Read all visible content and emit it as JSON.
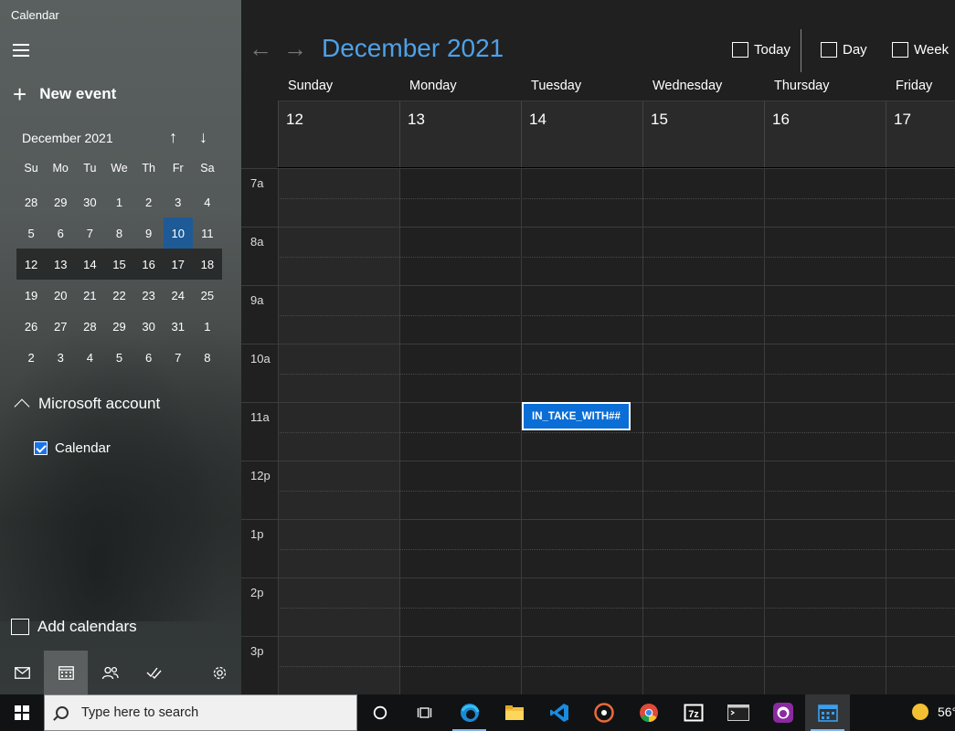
{
  "window": {
    "title": "Calendar"
  },
  "sidebar": {
    "new_event": "New event",
    "mini_calendar": {
      "month_label": "December 2021",
      "weekdays": [
        "Su",
        "Mo",
        "Tu",
        "We",
        "Th",
        "Fr",
        "Sa"
      ],
      "weeks": [
        [
          "28",
          "29",
          "30",
          "1",
          "2",
          "3",
          "4"
        ],
        [
          "5",
          "6",
          "7",
          "8",
          "9",
          "10",
          "11"
        ],
        [
          "12",
          "13",
          "14",
          "15",
          "16",
          "17",
          "18"
        ],
        [
          "19",
          "20",
          "21",
          "22",
          "23",
          "24",
          "25"
        ],
        [
          "26",
          "27",
          "28",
          "29",
          "30",
          "31",
          "1"
        ],
        [
          "2",
          "3",
          "4",
          "5",
          "6",
          "7",
          "8"
        ]
      ]
    },
    "account": "Microsoft account",
    "calendar_name": "Calendar",
    "add_calendars": "Add calendars"
  },
  "header": {
    "month_title": "December 2021",
    "today_label": "Today",
    "day_label": "Day",
    "week_label": "Week"
  },
  "week": {
    "days": [
      {
        "name": "Sunday",
        "num": "12"
      },
      {
        "name": "Monday",
        "num": "13"
      },
      {
        "name": "Tuesday",
        "num": "14"
      },
      {
        "name": "Wednesday",
        "num": "15"
      },
      {
        "name": "Thursday",
        "num": "16"
      },
      {
        "name": "Friday",
        "num": "17"
      }
    ],
    "hours": [
      "7a",
      "8a",
      "9a",
      "10a",
      "11a",
      "12p",
      "1p",
      "2p",
      "3p"
    ]
  },
  "event": {
    "title": "IN_TAKE_WITH##"
  },
  "taskbar": {
    "search_placeholder": "Type here to search",
    "weather_temp": "56°"
  },
  "colors": {
    "accent": "#4ea1e8",
    "today_highlight": "#1e5a96",
    "event_bg": "#0a6ed6"
  }
}
